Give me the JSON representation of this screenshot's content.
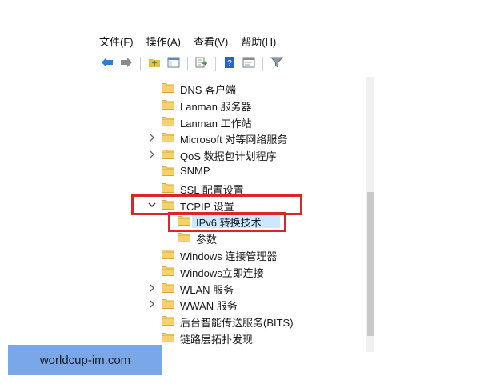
{
  "menu": [
    {
      "label": "文件(F)"
    },
    {
      "label": "操作(A)"
    },
    {
      "label": "查看(V)"
    },
    {
      "label": "帮助(H)"
    }
  ],
  "toolbar": [
    {
      "icon": "back-arrow-icon"
    },
    {
      "icon": "forward-arrow-icon"
    },
    {
      "icon": "up-folder-icon"
    },
    {
      "icon": "show-hide-tree-icon"
    },
    {
      "icon": "export-list-icon"
    },
    {
      "icon": "help-icon"
    },
    {
      "icon": "properties-icon"
    },
    {
      "icon": "filter-icon"
    }
  ],
  "tree": {
    "items": [
      {
        "label": "DNS 客户端",
        "expander": ""
      },
      {
        "label": "Lanman 服务器",
        "expander": ""
      },
      {
        "label": "Lanman 工作站",
        "expander": ""
      },
      {
        "label": "Microsoft 对等网络服务",
        "expander": "collapsed"
      },
      {
        "label": "QoS 数据包计划程序",
        "expander": "collapsed"
      },
      {
        "label": "SNMP",
        "expander": ""
      },
      {
        "label": "SSL 配置设置",
        "expander": ""
      },
      {
        "label": "TCPIP 设置",
        "expander": "expanded"
      },
      {
        "label": "IPv6 转换技术",
        "expander": "",
        "selected": true
      },
      {
        "label": "参数",
        "expander": ""
      },
      {
        "label": "Windows 连接管理器",
        "expander": ""
      },
      {
        "label": "Windows立即连接",
        "expander": ""
      },
      {
        "label": "WLAN 服务",
        "expander": "collapsed"
      },
      {
        "label": "WWAN 服务",
        "expander": "collapsed"
      },
      {
        "label": "后台智能传送服务(BITS)",
        "expander": ""
      },
      {
        "label": "链路层拓扑发现",
        "expander": ""
      }
    ]
  },
  "watermark": {
    "text": "worldcup-im.com"
  },
  "colors": {
    "highlight": "#d9262b",
    "selection": "#cce8ff",
    "folder": "#f5d26b",
    "watermark_bg": "#7aa7e8"
  }
}
